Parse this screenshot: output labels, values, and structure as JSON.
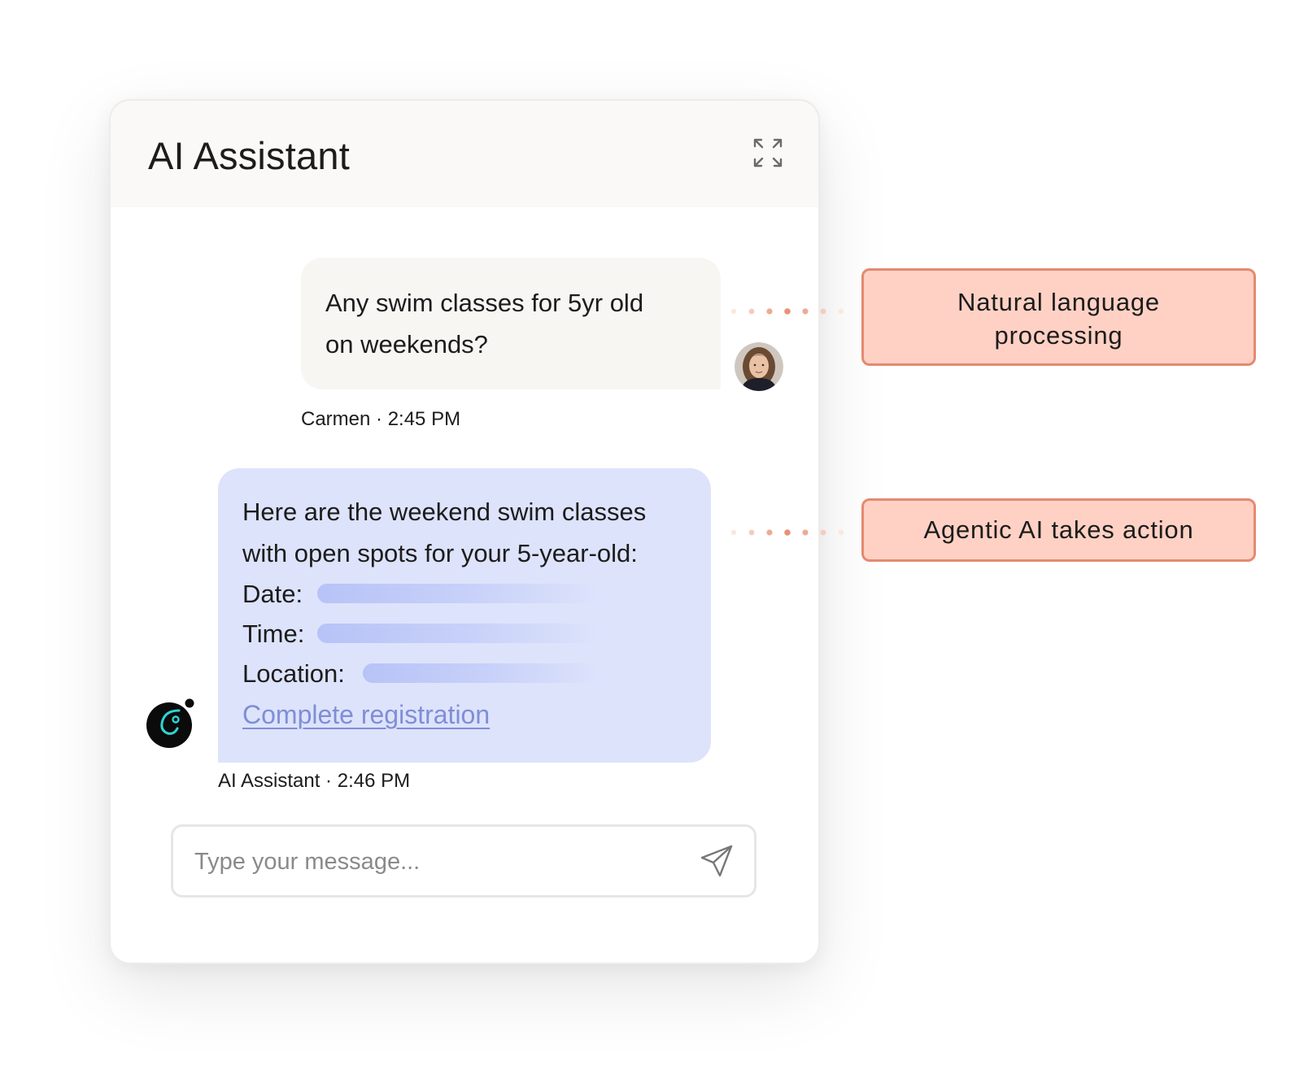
{
  "window": {
    "title": "AI Assistant"
  },
  "icons": {
    "expand": "expand-arrows-icon",
    "send": "paper-plane-icon",
    "user_avatar": "user-photo-avatar",
    "assistant_avatar": "assistant-logo-avatar"
  },
  "messages": {
    "user": {
      "line1": "Any swim classes for 5yr old",
      "line2": "on weekends?",
      "sender": "Carmen",
      "time": "2:45 PM",
      "meta": "Carmen · 2:45 PM"
    },
    "assistant": {
      "line1": "Here are the weekend swim classes",
      "line2": "with open spots for your 5-year-old:",
      "date_label": "Date:",
      "time_label": "Time:",
      "location_label": "Location:",
      "link_label": "Complete registration",
      "sender": "AI Assistant",
      "time": "2:46 PM",
      "meta": "AI Assistant · 2:46 PM"
    }
  },
  "composer": {
    "placeholder": "Type your message..."
  },
  "callouts": {
    "nlp_line1": "Natural language",
    "nlp_line2": "processing",
    "agentic": "Agentic AI takes action"
  },
  "colors": {
    "user_bubble": "#f7f6f3",
    "assistant_bubble": "#dde3fb",
    "link": "#7f8ed6",
    "callout_fill": "#ffd1c4",
    "callout_border": "#e38a71",
    "assistant_logo_bg": "#0b0b0b",
    "assistant_logo_accent": "#2ed3d3"
  }
}
